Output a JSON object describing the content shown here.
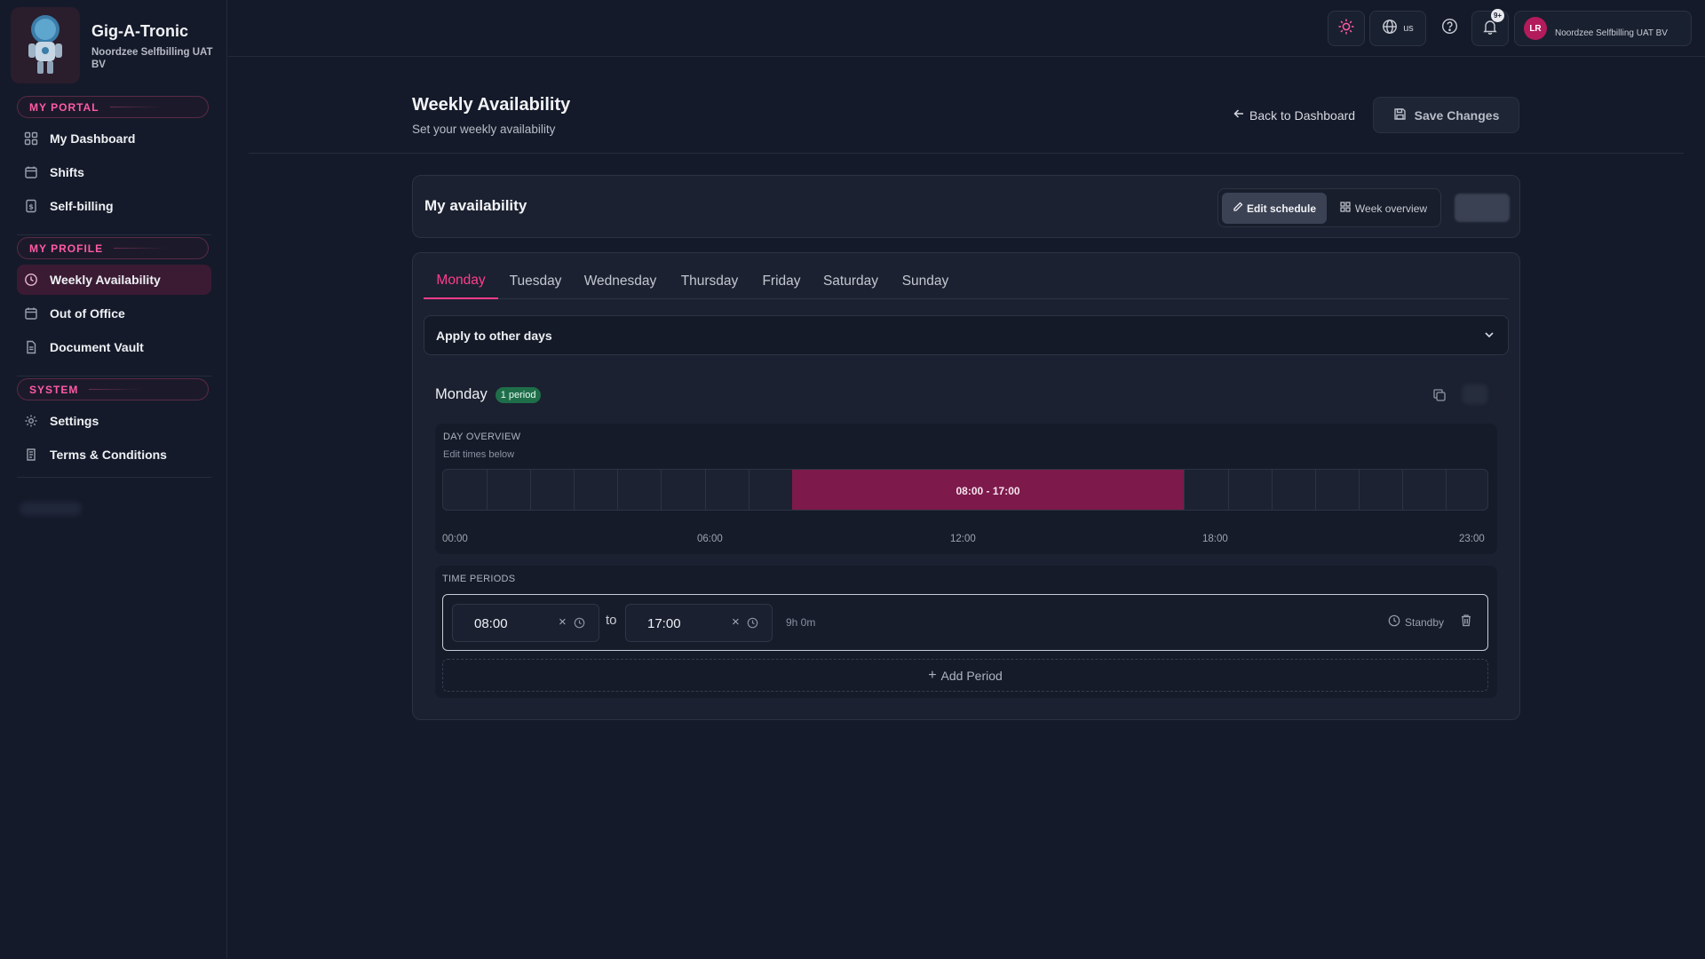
{
  "app": {
    "name": "Gig-A-Tronic",
    "org": "Noordzee Selfbilling UAT BV"
  },
  "sidebar": {
    "sections": [
      {
        "label": "MY PORTAL",
        "items": [
          {
            "label": "My Dashboard",
            "icon": "dashboard-icon"
          },
          {
            "label": "Shifts",
            "icon": "calendar-icon"
          },
          {
            "label": "Self-billing",
            "icon": "billing-icon"
          }
        ]
      },
      {
        "label": "MY PROFILE",
        "items": [
          {
            "label": "Weekly Availability",
            "icon": "clock-icon",
            "active": true
          },
          {
            "label": "Out of Office",
            "icon": "calendar-icon"
          },
          {
            "label": "Document Vault",
            "icon": "document-icon"
          }
        ]
      },
      {
        "label": "SYSTEM",
        "items": [
          {
            "label": "Settings",
            "icon": "gear-icon"
          },
          {
            "label": "Terms & Conditions",
            "icon": "scroll-icon"
          }
        ]
      }
    ]
  },
  "topbar": {
    "language": "us",
    "notification_badge": "9+",
    "user_initials": "LR",
    "user_org": "Noordzee Selfbilling UAT BV"
  },
  "page": {
    "title": "Weekly Availability",
    "subtitle": "Set your weekly availability",
    "back_label": "Back to Dashboard",
    "save_label": "Save Changes"
  },
  "availability": {
    "title": "My availability",
    "view_modes": [
      "Edit schedule",
      "Week overview"
    ],
    "active_view": "Edit schedule"
  },
  "days": {
    "tabs": [
      "Monday",
      "Tuesday",
      "Wednesday",
      "Thursday",
      "Friday",
      "Saturday",
      "Sunday"
    ],
    "active": "Monday",
    "apply_label": "Apply to other days"
  },
  "day": {
    "name": "Monday",
    "period_count": "1 period",
    "overview_label": "DAY OVERVIEW",
    "overview_hint": "Edit times below",
    "range_label": "08:00 - 17:00",
    "range_start_hour": 8,
    "range_end_hour": 17,
    "hours_shown": 24,
    "ticks": [
      "00:00",
      "06:00",
      "12:00",
      "18:00",
      "23:00"
    ]
  },
  "periods": {
    "label": "TIME PERIODS",
    "rows": [
      {
        "from": "08:00",
        "to_word": "to",
        "to": "17:00",
        "duration": "9h 0m",
        "standby": "Standby"
      }
    ],
    "add_label": "Add Period"
  },
  "colors": {
    "accent": "#ff3d8e",
    "range": "#7d1a4b",
    "background": "#141a29"
  }
}
